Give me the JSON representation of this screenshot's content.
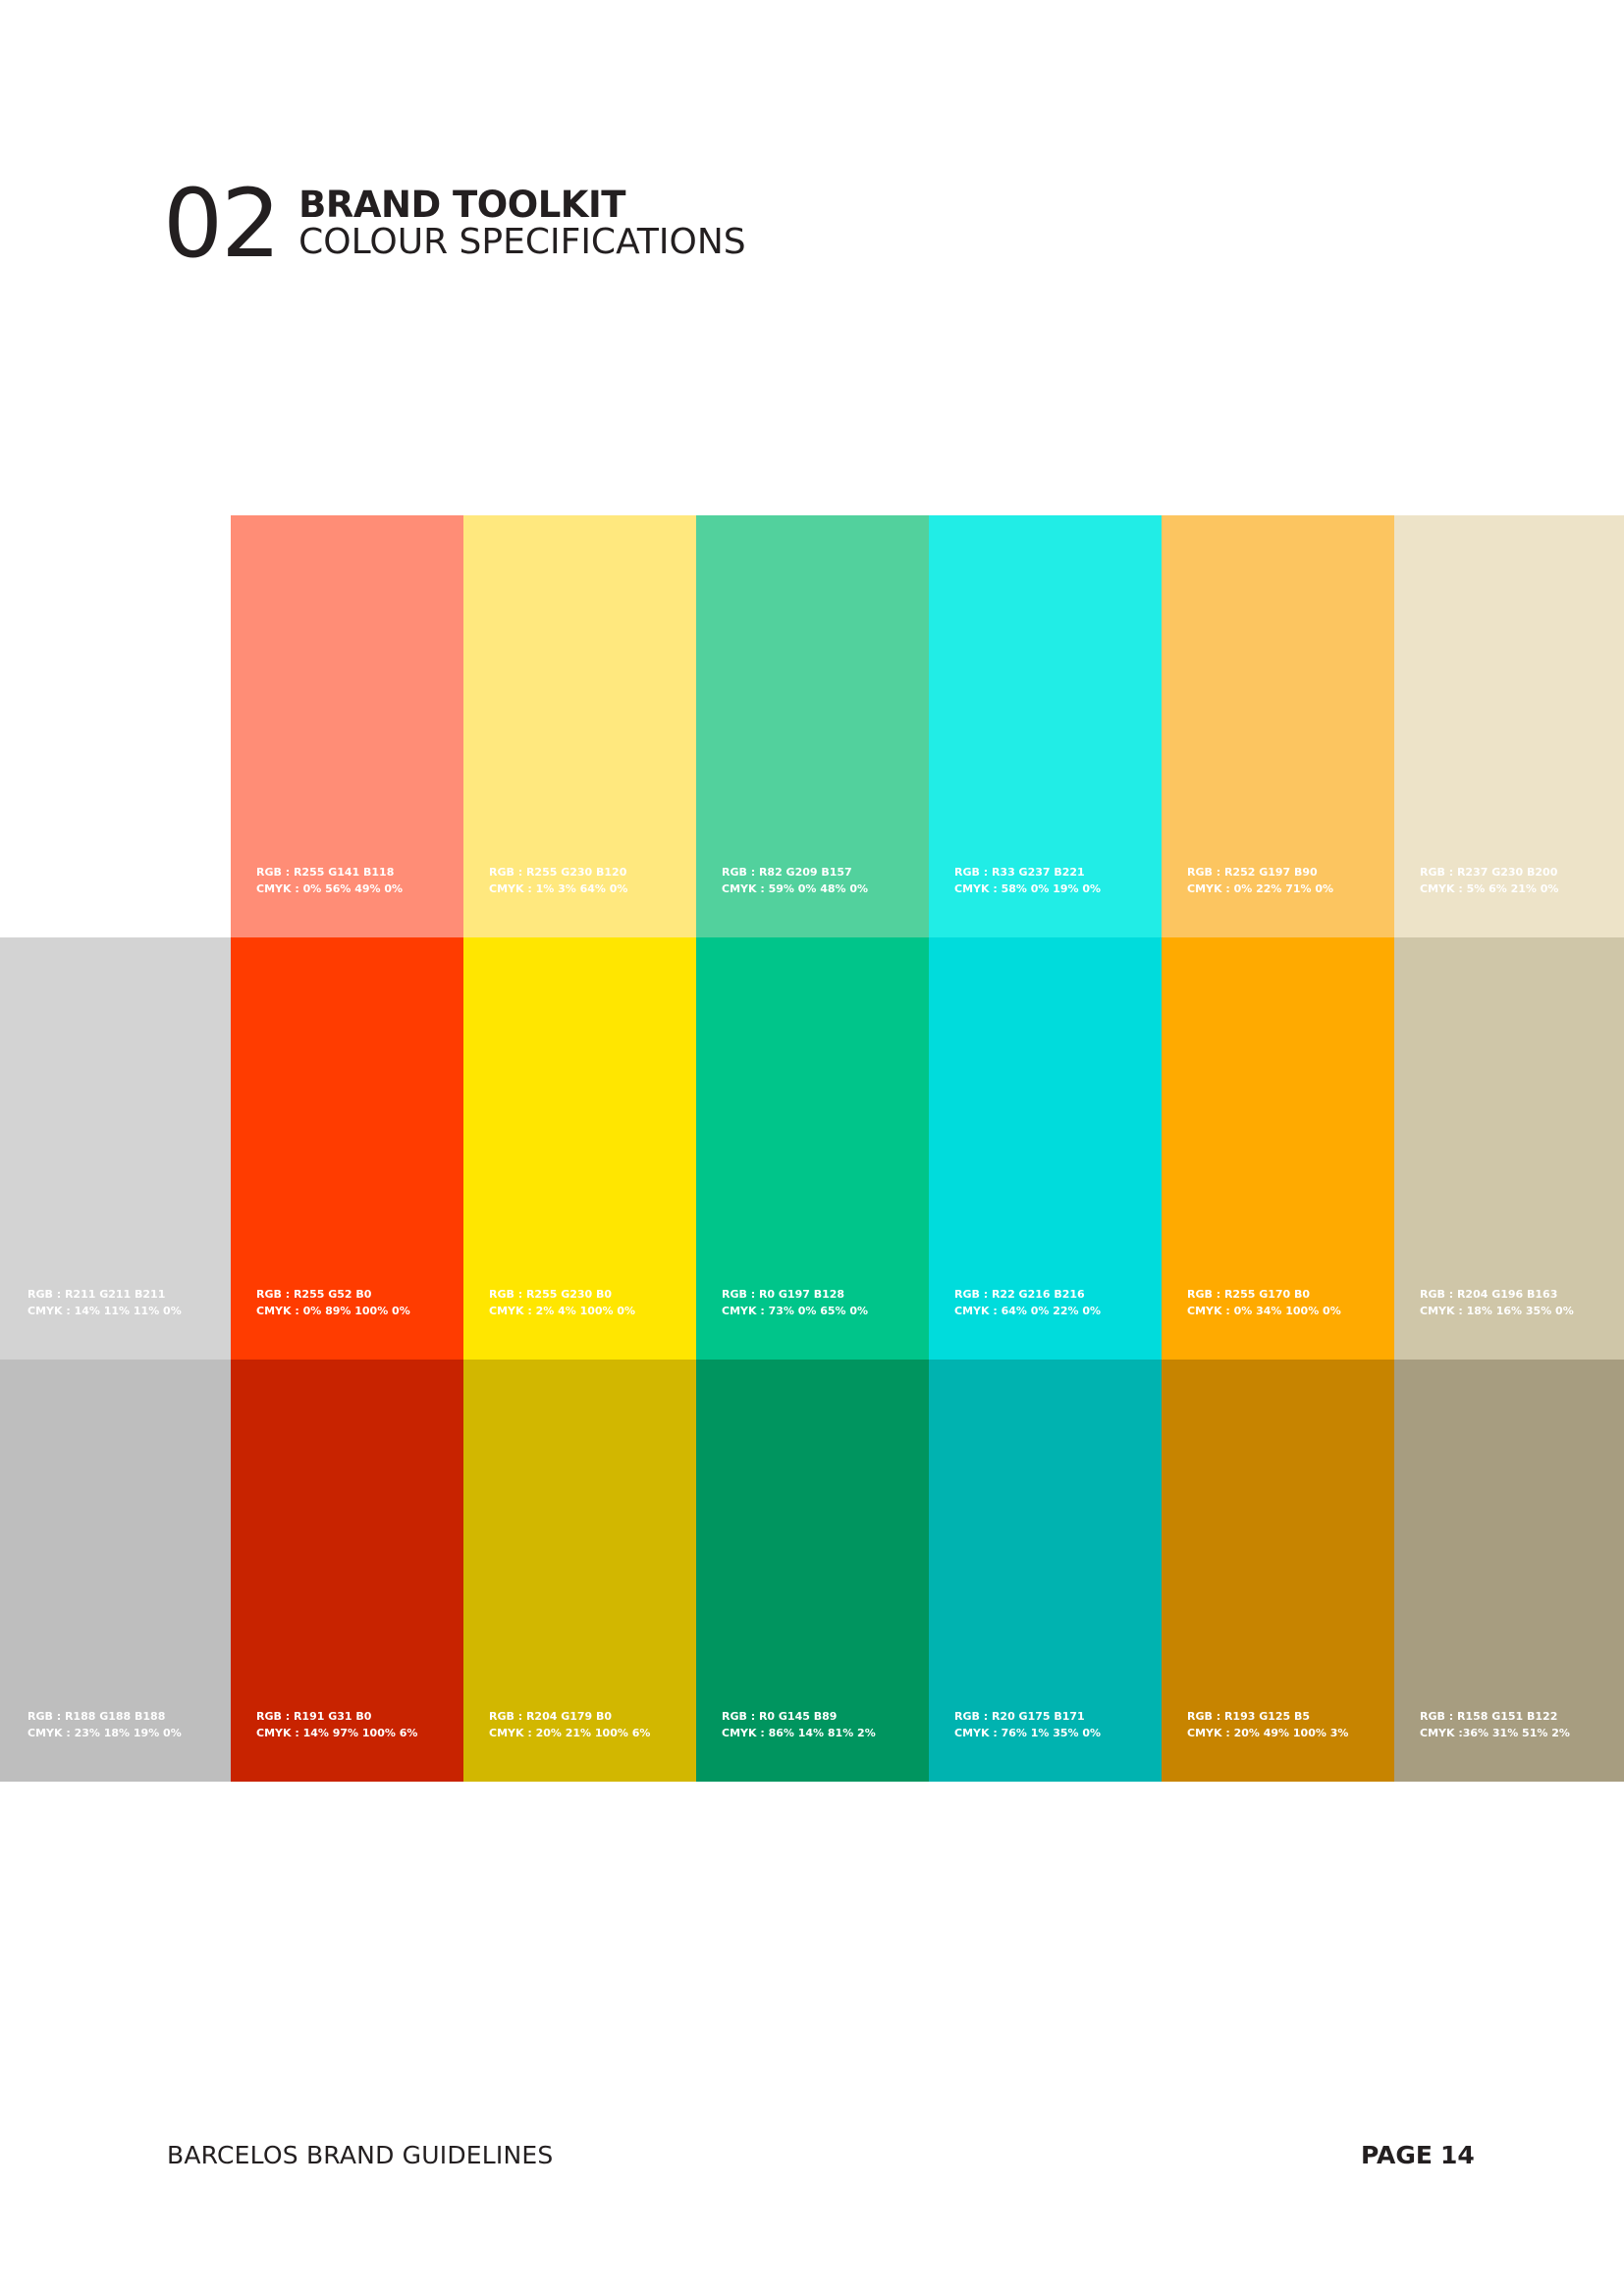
{
  "header": {
    "number": "02",
    "title": "BRAND TOOLKIT",
    "subtitle": "COLOUR SPECIFICATIONS"
  },
  "swatches": [
    {
      "row": 0,
      "col": 1,
      "color": "#ff8d76",
      "rgb": "RGB : R255 G141 B118",
      "cmyk": "CMYK : 0% 56% 49% 0%"
    },
    {
      "row": 0,
      "col": 2,
      "color": "#ffe87e",
      "rgb": "RGB : R255 G230 B120",
      "cmyk": "CMYK : 1% 3% 64% 0%"
    },
    {
      "row": 0,
      "col": 3,
      "color": "#52d19d",
      "rgb": "RGB : R82 G209 B157",
      "cmyk": "CMYK : 59% 0% 48% 0%"
    },
    {
      "row": 0,
      "col": 4,
      "color": "#21ede6",
      "rgb": "RGB : R33 G237 B221",
      "cmyk": "CMYK : 58% 0% 19% 0%"
    },
    {
      "row": 0,
      "col": 5,
      "color": "#fcc560",
      "rgb": "RGB : R252 G197 B90",
      "cmyk": "CMYK : 0% 22% 71% 0%"
    },
    {
      "row": 0,
      "col": 6,
      "color": "#ede3c8",
      "rgb": "RGB : R237 G230 B200",
      "cmyk": "CMYK : 5% 6% 21% 0%"
    },
    {
      "row": 1,
      "col": 0,
      "color": "#d3d3d3",
      "rgb": "RGB : R211 G211 B211",
      "cmyk": "CMYK : 14% 11% 11% 0%"
    },
    {
      "row": 1,
      "col": 1,
      "color": "#ff3c00",
      "rgb": "RGB : R255 G52 B0",
      "cmyk": "CMYK : 0% 89% 100% 0%"
    },
    {
      "row": 1,
      "col": 2,
      "color": "#ffe600",
      "rgb": "RGB : R255 G230 B0",
      "cmyk": "CMYK : 2% 4% 100% 0%"
    },
    {
      "row": 1,
      "col": 3,
      "color": "#00c58a",
      "rgb": "RGB : R0 G197 B128",
      "cmyk": "CMYK : 73% 0% 65% 0%"
    },
    {
      "row": 1,
      "col": 4,
      "color": "#00dcdc",
      "rgb": "RGB : R22 G216 B216",
      "cmyk": "CMYK : 64% 0% 22% 0%"
    },
    {
      "row": 1,
      "col": 5,
      "color": "#ffaa00",
      "rgb": "RGB : R255 G170 B0",
      "cmyk": "CMYK : 0% 34% 100% 0%"
    },
    {
      "row": 1,
      "col": 6,
      "color": "#cfc6a8",
      "rgb": "RGB : R204 G196 B163",
      "cmyk": "CMYK : 18% 16% 35% 0%"
    },
    {
      "row": 2,
      "col": 0,
      "color": "#bebebe",
      "rgb": "RGB : R188 G188 B188",
      "cmyk": "CMYK : 23% 18% 19% 0%"
    },
    {
      "row": 2,
      "col": 1,
      "color": "#c82300",
      "rgb": "RGB : R191 G31 B0",
      "cmyk": "CMYK : 14% 97% 100% 6%"
    },
    {
      "row": 2,
      "col": 2,
      "color": "#d2b700",
      "rgb": "RGB : R204 G179 B0",
      "cmyk": "CMYK : 20% 21% 100% 6%"
    },
    {
      "row": 2,
      "col": 3,
      "color": "#00955f",
      "rgb": "RGB : R0 G145 B89",
      "cmyk": "CMYK : 86% 14% 81% 2%"
    },
    {
      "row": 2,
      "col": 4,
      "color": "#00b3b0",
      "rgb": "RGB : R20 G175 B171",
      "cmyk": "CMYK : 76% 1% 35% 0%"
    },
    {
      "row": 2,
      "col": 5,
      "color": "#c78400",
      "rgb": "RGB : R193 G125 B5",
      "cmyk": "CMYK : 20% 49% 100% 3%"
    },
    {
      "row": 2,
      "col": 6,
      "color": "#a79d80",
      "rgb": "RGB : R158 G151 B122",
      "cmyk": "CMYK :36% 31% 51% 2%"
    }
  ],
  "footer": {
    "left": "BARCELOS BRAND GUIDELINES",
    "page_label": "PAGE",
    "page_number": "14"
  }
}
